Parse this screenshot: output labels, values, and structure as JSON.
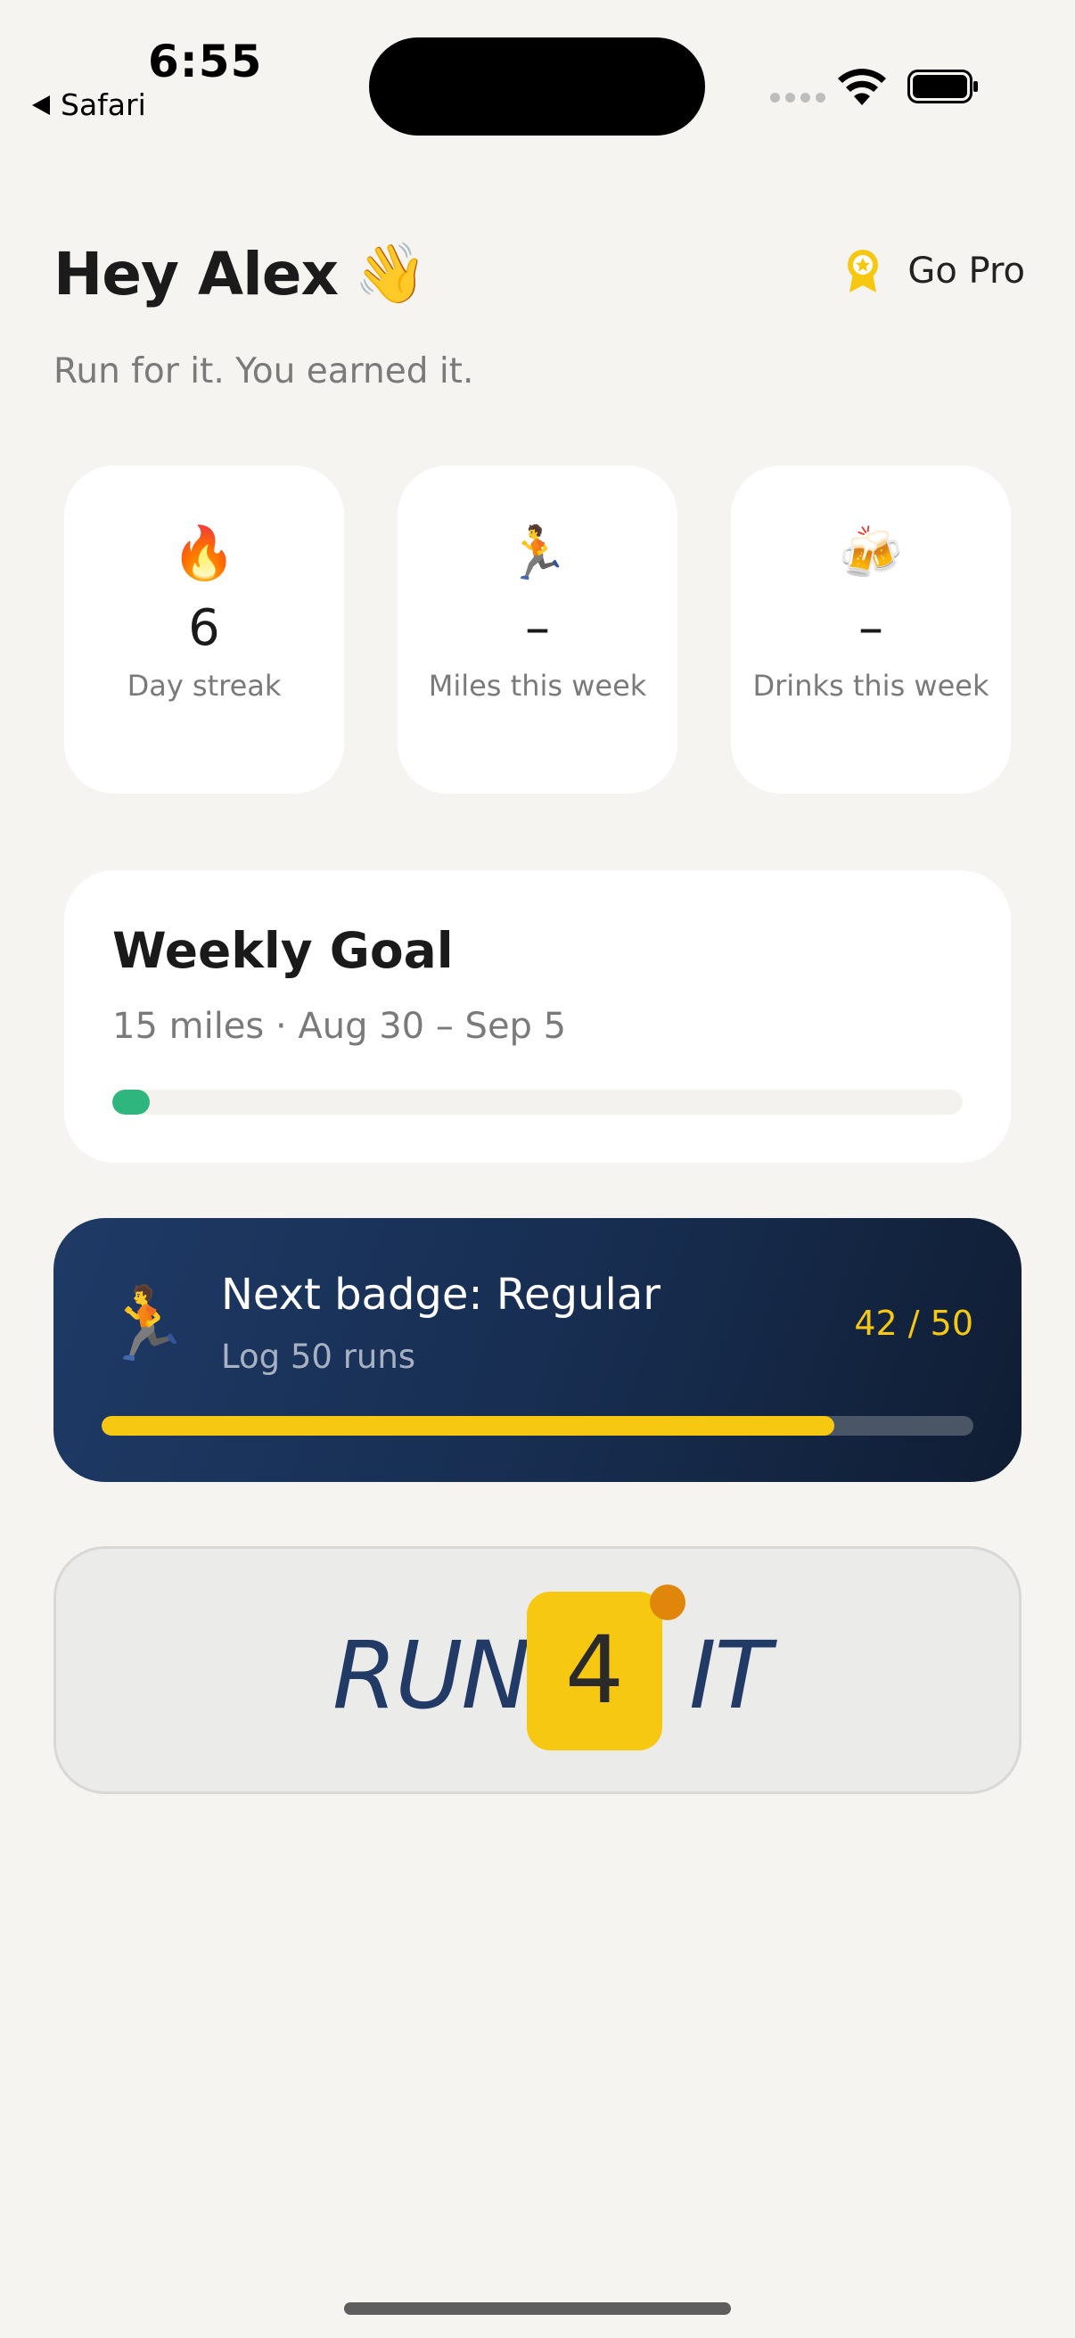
{
  "status_bar": {
    "time": "6:55",
    "back_label": "Safari"
  },
  "header": {
    "greeting": "Hey Alex",
    "wave_emoji": "👋",
    "go_pro_label": "Go Pro",
    "go_pro_icon": "award-ribbon-icon"
  },
  "subtitle": "Run for it. You earned it.",
  "stats": [
    {
      "emoji": "🔥",
      "value": "6",
      "label": "Day streak"
    },
    {
      "emoji": "🏃",
      "value": "–",
      "label": "Miles this week"
    },
    {
      "emoji": "🍻",
      "value": "–",
      "label": "Drinks this week"
    }
  ],
  "weekly_goal": {
    "title": "Weekly Goal",
    "subtitle": "15 miles · Aug 30 – Sep 5",
    "progress_fraction": 0.044,
    "color": "#2fb57e"
  },
  "next_badge": {
    "emoji": "🏃",
    "title": "Next badge: Regular",
    "subtitle": "Log 50 runs",
    "count": "42 / 50",
    "progress_fraction": 0.84,
    "color": "#f7c812"
  },
  "logo": {
    "left": "RUN",
    "number": "4",
    "right": "IT",
    "brand_colors": {
      "navy": "#213a66",
      "yellow": "#f7c812",
      "orange": "#e0860b"
    }
  }
}
